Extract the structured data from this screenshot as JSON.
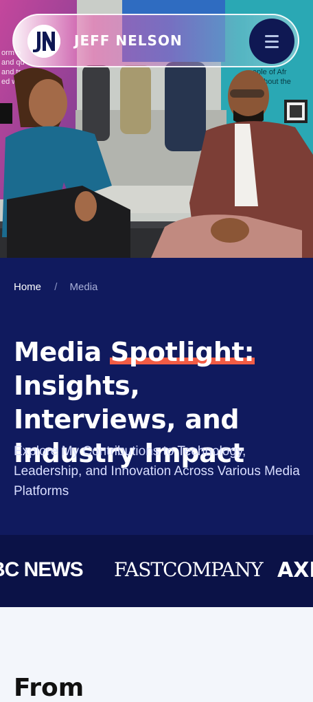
{
  "header": {
    "logo_icon": "jn-monogram-icon",
    "logo_initials": "JN",
    "brand_name": "JEFF NELSON",
    "menu_icon": "hamburger-menu-icon"
  },
  "breadcrumb": {
    "home": "Home",
    "separator": "/",
    "current": "Media"
  },
  "hero_title": {
    "before": "Media ",
    "highlight": "Spotlight:",
    "after": " Insights, Interviews, and Industry Impact"
  },
  "subtitle": "Explore My Contributions to Technology, Leadership, and Innovation Across Various Media Platforms",
  "media_logos": [
    "BC NEWS",
    "FASTCOMPANY",
    "AXI"
  ],
  "next_section_heading": "From",
  "colors": {
    "navy": "#101a5e",
    "logo_strip": "#0b1247",
    "accent_underline": "#f25c45",
    "menu_button": "#0f1853"
  }
}
